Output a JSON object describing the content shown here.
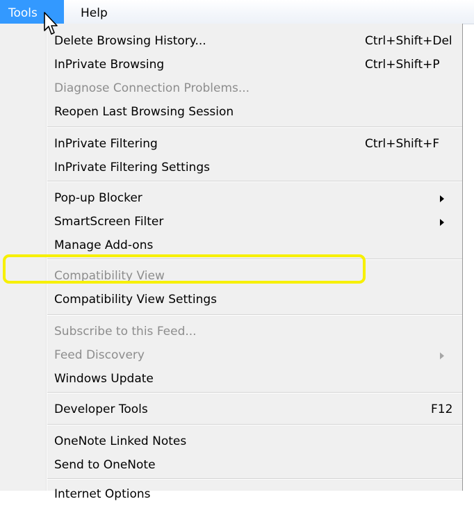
{
  "menubar": {
    "tools_label": "Tools",
    "help_label": "Help"
  },
  "menu": {
    "items": [
      {
        "label": "Delete Browsing History...",
        "shortcut": "Ctrl+Shift+Del",
        "enabled": true
      },
      {
        "label": "InPrivate Browsing",
        "shortcut": "Ctrl+Shift+P",
        "enabled": true
      },
      {
        "label": "Diagnose Connection Problems...",
        "shortcut": "",
        "enabled": false
      },
      {
        "label": "Reopen Last Browsing Session",
        "shortcut": "",
        "enabled": true
      },
      {
        "label": "InPrivate Filtering",
        "shortcut": "Ctrl+Shift+F",
        "enabled": true
      },
      {
        "label": "InPrivate Filtering Settings",
        "shortcut": "",
        "enabled": true
      },
      {
        "label": "Pop-up Blocker",
        "shortcut": "",
        "enabled": true,
        "submenu": true
      },
      {
        "label": "SmartScreen Filter",
        "shortcut": "",
        "enabled": true,
        "submenu": true
      },
      {
        "label": "Manage Add-ons",
        "shortcut": "",
        "enabled": true
      },
      {
        "label": "Compatibility View",
        "shortcut": "",
        "enabled": false
      },
      {
        "label": "Compatibility View Settings",
        "shortcut": "",
        "enabled": true,
        "highlighted": true
      },
      {
        "label": "Subscribe to this Feed...",
        "shortcut": "",
        "enabled": false
      },
      {
        "label": "Feed Discovery",
        "shortcut": "",
        "enabled": false,
        "submenu": true
      },
      {
        "label": "Windows Update",
        "shortcut": "",
        "enabled": true
      },
      {
        "label": "Developer Tools",
        "shortcut": "F12",
        "enabled": true
      },
      {
        "label": "OneNote Linked Notes",
        "shortcut": "",
        "enabled": true
      },
      {
        "label": "Send to OneNote",
        "shortcut": "",
        "enabled": true
      },
      {
        "label": "Internet Options",
        "shortcut": "",
        "enabled": true
      }
    ]
  },
  "colors": {
    "menubar_selected_bg": "#3399ff",
    "menu_bg": "#f0f0f0",
    "disabled_text": "#8d8d8d",
    "highlight_outline": "#f7f000"
  },
  "icons": {
    "cursor": "mouse-pointer-icon",
    "submenu_arrow": "submenu-arrow-icon"
  }
}
